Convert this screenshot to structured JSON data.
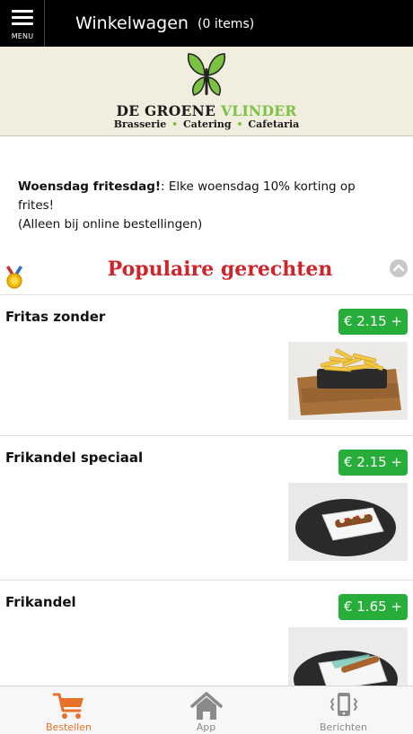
{
  "topbar": {
    "menu_label": "MENU",
    "title": "Winkelwagen",
    "cart_count": "(0 items)"
  },
  "brand": {
    "name_part1": "DE GROENE ",
    "name_part2": "VLINDER",
    "tag1": "Brasserie",
    "tag2": "Catering",
    "tag3": "Cafetaria",
    "separator": "•",
    "colors": {
      "green": "#7cc242",
      "dark": "#1a1a1a",
      "band": "#f1eedf"
    }
  },
  "promo": {
    "bold": "Woensdag fritesdag!",
    "text": ": Elke woensdag 10% korting op frites!",
    "note": "(Alleen bij online bestellingen)"
  },
  "section": {
    "title": "Populaire gerechten",
    "icon": "medal-icon",
    "title_color": "#d1232a"
  },
  "products": [
    {
      "name": "Fritas zonder",
      "price": "€ 2.15 +",
      "image": "fries-on-board"
    },
    {
      "name": "Frikandel speciaal",
      "price": "€ 2.15 +",
      "image": "frikandel-special-on-plate"
    },
    {
      "name": "Frikandel",
      "price": "€ 1.65 +",
      "image": "frikandel-on-plate"
    }
  ],
  "price_color": "#27ae3a",
  "bottom_nav": [
    {
      "label": "Bestellen",
      "icon": "cart-icon",
      "active": true
    },
    {
      "label": "App",
      "icon": "home-icon",
      "active": false
    },
    {
      "label": "Berichten",
      "icon": "phone-vibrate-icon",
      "active": false
    }
  ],
  "nav_colors": {
    "active": "#e8722b",
    "inactive": "#8a8a8a"
  }
}
